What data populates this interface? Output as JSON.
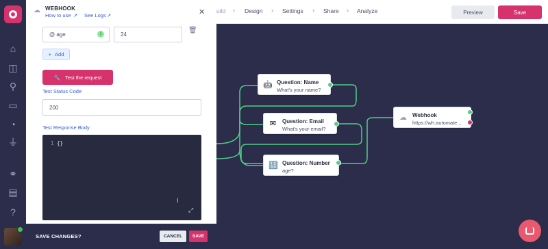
{
  "colors": {
    "brand": "#d6336c",
    "canvas": "#2b2d4a",
    "link": "#3b5bdb",
    "edge": "#51cf86"
  },
  "topbar": {
    "crumbs": [
      "uild",
      "Design",
      "Settings",
      "Share",
      "Analyze"
    ],
    "preview_label": "Preview",
    "save_label": "Save"
  },
  "panel": {
    "title": "WEBHOOK",
    "how_to_use": "How to use",
    "see_logs": "See Logs",
    "variable_name": "@ age",
    "variable_badge": "1",
    "variable_value": "24",
    "add_label": "Add",
    "test_button": "Test the request",
    "status_label": "Test Status Code",
    "status_value": "200",
    "response_label": "Test Response Body",
    "response_line": "1",
    "response_code": "{}"
  },
  "nodes": {
    "name": {
      "title": "Question: Name",
      "subtitle": "What's your name?",
      "icon": "robot-face-icon"
    },
    "email": {
      "title": "Question: Email",
      "subtitle": "What's your email?",
      "icon": "envelope-icon"
    },
    "number": {
      "title": "Question: Number",
      "subtitle": "age?",
      "icon": "number-keypad-icon"
    },
    "webhook": {
      "title": "Webhook",
      "subtitle": "https://wh.automate...",
      "icon": "cloud-icon"
    }
  },
  "savebar": {
    "label": "SAVE CHANGES?",
    "cancel": "CANCEL",
    "save": "SAVE"
  }
}
